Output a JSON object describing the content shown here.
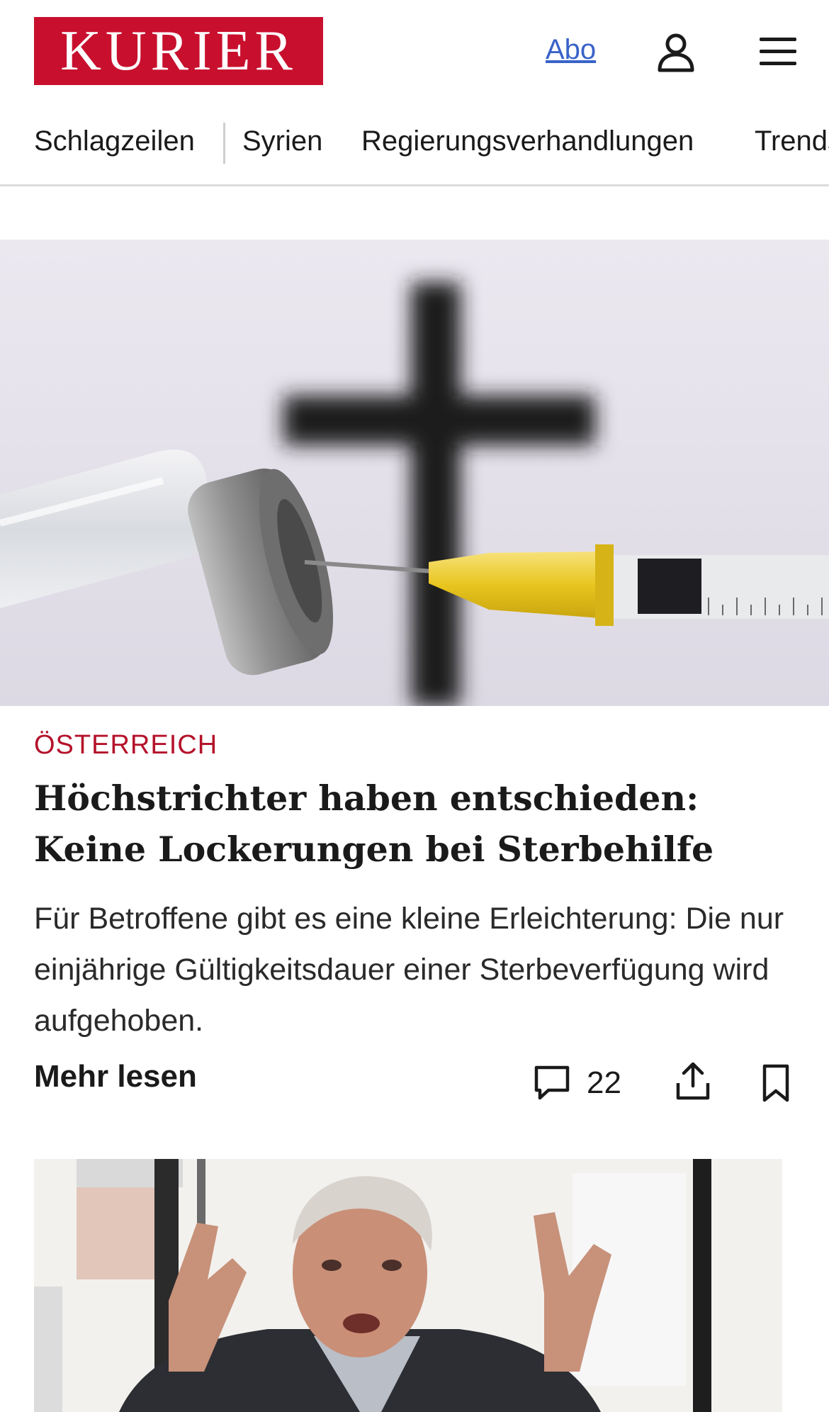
{
  "header": {
    "logo_text": "KURIER",
    "abo_label": "Abo",
    "user_icon": "user-icon",
    "menu_icon": "hamburger-menu-icon"
  },
  "nav": {
    "items": [
      "Schlagzeilen",
      "Syrien",
      "Regierungsverhandlungen",
      "Trends"
    ]
  },
  "article": {
    "category": "ÖSTERREICH",
    "headline": "Höchstrichter haben entschieden: Keine Lockerungen bei Sterbehilfe",
    "teaser": "Für Betroffene gibt es eine kleine Erleichterung: Die nur einjährige Gültigkeitsdauer einer Sterbeverfügung wird aufgehoben.",
    "more_label": "Mehr lesen",
    "comment_count": "22",
    "icons": [
      "comment-icon",
      "share-icon",
      "bookmark-icon"
    ]
  },
  "colors": {
    "brand_red": "#c8102e",
    "category_red": "#b5122b",
    "link_blue": "#3a63c8"
  }
}
